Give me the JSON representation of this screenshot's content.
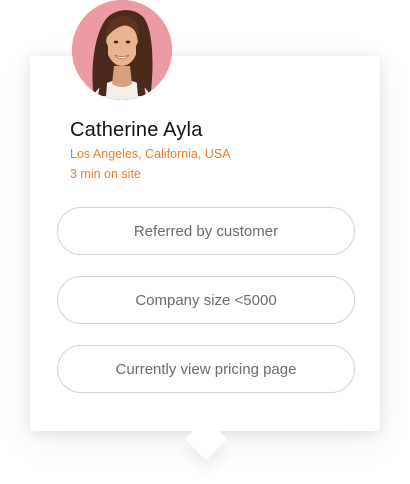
{
  "profile": {
    "name": "Catherine Ayla",
    "location": "Los Angeles, California, USA",
    "time_on_site": "3 min on site"
  },
  "tags": [
    {
      "label": "Referred by customer"
    },
    {
      "label": "Company size <5000"
    },
    {
      "label": "Currently view pricing page"
    }
  ],
  "colors": {
    "accent": "#ee7b2c",
    "avatar_background": "#ee9aa3",
    "name_text": "#111111",
    "pill_text": "#6b6b6b",
    "pill_border": "#d3d3d3"
  }
}
